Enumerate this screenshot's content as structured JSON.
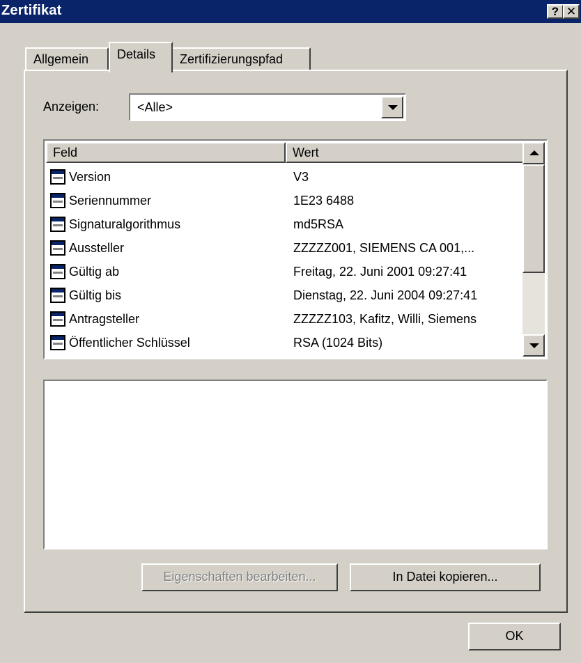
{
  "window": {
    "title": "Zertifikat",
    "help_button": "?",
    "close_button": "✕"
  },
  "tabs": [
    {
      "label": "Allgemein",
      "selected": false
    },
    {
      "label": "Details",
      "selected": true
    },
    {
      "label": "Zertifizierungspfad",
      "selected": false
    }
  ],
  "filter": {
    "label": "Anzeigen:",
    "value": "<Alle>"
  },
  "list": {
    "columns": [
      "Feld",
      "Wert"
    ],
    "rows": [
      {
        "field": "Version",
        "value": "V3"
      },
      {
        "field": "Seriennummer",
        "value": "1E23 6488"
      },
      {
        "field": "Signaturalgorithmus",
        "value": "md5RSA"
      },
      {
        "field": "Aussteller",
        "value": "ZZZZZ001, SIEMENS CA 001,..."
      },
      {
        "field": "Gültig ab",
        "value": "Freitag, 22. Juni 2001 09:27:41"
      },
      {
        "field": "Gültig bis",
        "value": "Dienstag, 22. Juni 2004 09:27:41"
      },
      {
        "field": "Antragsteller",
        "value": "ZZZZZ103, Kafitz, Willi, Siemens"
      },
      {
        "field": "Öffentlicher Schlüssel",
        "value": "RSA (1024 Bits)"
      }
    ]
  },
  "detail_text": "",
  "buttons": {
    "edit_properties": "Eigenschaften bearbeiten...",
    "copy_to_file": "In Datei kopieren...",
    "ok": "OK"
  },
  "colors": {
    "titlebar": "#0a246a",
    "face": "#d4d0c8"
  }
}
